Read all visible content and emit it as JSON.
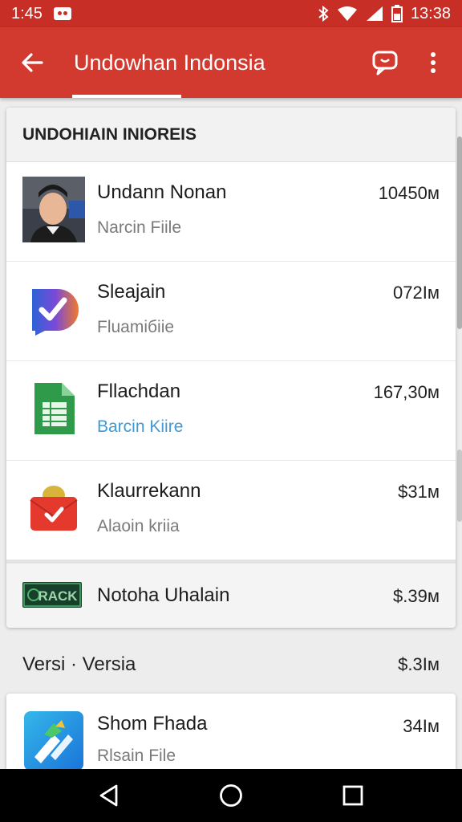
{
  "status_bar": {
    "time_left": "1:45",
    "time_right": "13:38"
  },
  "appbar": {
    "title": "Undowhan Indonsia"
  },
  "list_header": "UNDOHIAIN INIOREIS",
  "items": [
    {
      "name": "Undann Nonan",
      "sub": "Narcin Fiile",
      "value": "10450м"
    },
    {
      "name": "Sleajain",
      "sub": "Fluamiбiie",
      "value": "072Iм"
    },
    {
      "name": "Fllachdan",
      "sub": "Barcin Kiire",
      "value": "167,30м"
    },
    {
      "name": "Klaurrekann",
      "sub": "Alaoin kriia",
      "value": "$31м"
    }
  ],
  "last_item": {
    "badge": "RACK",
    "name": "Notoha Uhalain",
    "value": "$.39м"
  },
  "section": {
    "label": "Versi · Versia",
    "value": "$.3Iм"
  },
  "bottom_item": {
    "name": "Shom Fhada",
    "sub": "Rlsain File",
    "value": "34Iм"
  },
  "colors": {
    "statusbar": "#c62e26",
    "appbar": "#d33a2f",
    "link_blue": "#3f99d6"
  },
  "icons": [
    "back-arrow-icon",
    "chat-bubble-icon",
    "more-vert-icon",
    "bluetooth-icon",
    "wifi-icon",
    "signal-icon",
    "battery-icon",
    "nav-back-icon",
    "nav-home-icon",
    "nav-recents-icon"
  ]
}
